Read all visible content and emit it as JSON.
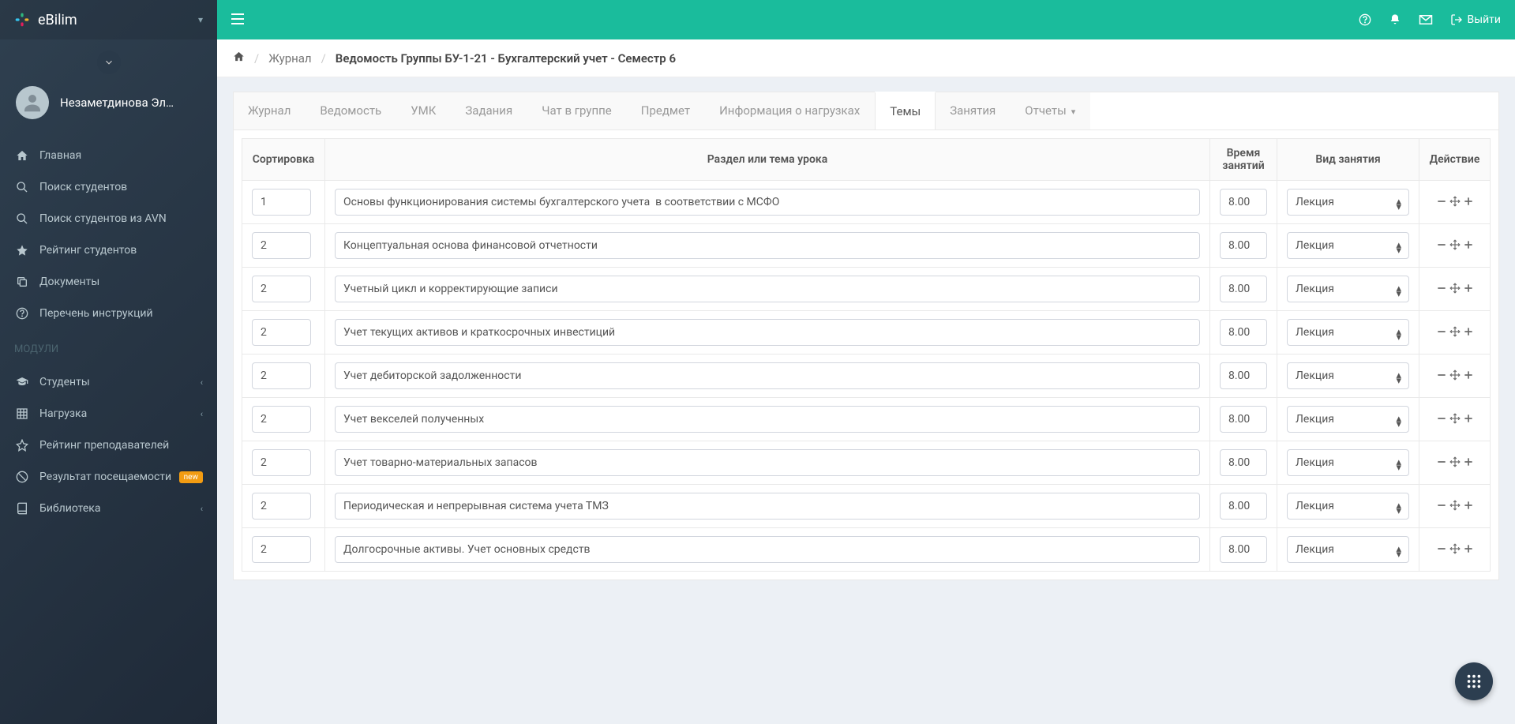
{
  "brand": {
    "name": "eBilim"
  },
  "user": {
    "name": "Незаметдинова Эл…"
  },
  "sidebar": {
    "header": "МОДУЛИ",
    "items": [
      {
        "label": "Главная",
        "icon": "home"
      },
      {
        "label": "Поиск студентов",
        "icon": "search"
      },
      {
        "label": "Поиск студентов из AVN",
        "icon": "search"
      },
      {
        "label": "Рейтинг студентов",
        "icon": "star"
      },
      {
        "label": "Документы",
        "icon": "copy"
      },
      {
        "label": "Перечень инструкций",
        "icon": "help"
      }
    ],
    "modules": [
      {
        "label": "Студенты",
        "icon": "grad",
        "chev": true
      },
      {
        "label": "Нагрузка",
        "icon": "table",
        "chev": true
      },
      {
        "label": "Рейтинг преподавателей",
        "icon": "star-o"
      },
      {
        "label": "Результат посещаемости",
        "icon": "ban",
        "badge": "new"
      },
      {
        "label": "Библиотека",
        "icon": "book",
        "chev": true
      }
    ]
  },
  "topbar": {
    "logout": "Выйти"
  },
  "breadcrumb": {
    "journal": "Журнал",
    "current": "Ведомость Группы БУ-1-21 - Бухгалтерский учет - Семестр 6"
  },
  "tabs": [
    {
      "label": "Журнал"
    },
    {
      "label": "Ведомость"
    },
    {
      "label": "УМК"
    },
    {
      "label": "Задания"
    },
    {
      "label": "Чат в группе"
    },
    {
      "label": "Предмет"
    },
    {
      "label": "Информация о нагрузках"
    },
    {
      "label": "Темы",
      "active": true
    },
    {
      "label": "Занятия"
    },
    {
      "label": "Отчеты",
      "dropdown": true
    }
  ],
  "table": {
    "headers": {
      "sort": "Сортировка",
      "topic": "Раздел или тема урока",
      "time": "Время занятий",
      "type": "Вид занятия",
      "action": "Действие"
    },
    "type_option": "Лекция",
    "rows": [
      {
        "sort": "1",
        "topic": "Основы функционирования системы бухгалтерского учета  в соответствии с МСФО",
        "time": "8.00",
        "type": "Лекция"
      },
      {
        "sort": "2",
        "topic": "Концептуальная основа финансовой отчетности",
        "time": "8.00",
        "type": "Лекция"
      },
      {
        "sort": "2",
        "topic": "Учетный цикл и корректирующие записи",
        "time": "8.00",
        "type": "Лекция"
      },
      {
        "sort": "2",
        "topic": "Учет текущих активов и краткосрочных инвестиций",
        "time": "8.00",
        "type": "Лекция"
      },
      {
        "sort": "2",
        "topic": "Учет дебиторской задолженности",
        "time": "8.00",
        "type": "Лекция"
      },
      {
        "sort": "2",
        "topic": "Учет векселей полученных",
        "time": "8.00",
        "type": "Лекция"
      },
      {
        "sort": "2",
        "topic": "Учет товарно-материальных запасов",
        "time": "8.00",
        "type": "Лекция"
      },
      {
        "sort": "2",
        "topic": "Периодическая и непрерывная система учета ТМЗ",
        "time": "8.00",
        "type": "Лекция"
      },
      {
        "sort": "2",
        "topic": "Долгосрочные активы. Учет основных средств",
        "time": "8.00",
        "type": "Лекция"
      }
    ]
  }
}
